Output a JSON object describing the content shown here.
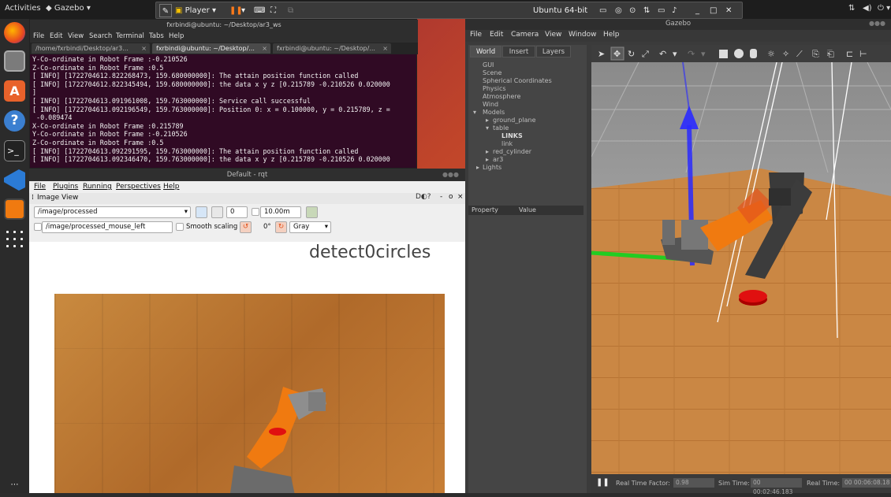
{
  "topbar": {
    "activities": "Activities",
    "app": "Gazebo",
    "vm_player": "Player",
    "vm_name": "Ubuntu 64-bit"
  },
  "terminal": {
    "title": "fxrbindi@ubuntu: ~/Desktop/ar3_ws",
    "menu": [
      "File",
      "Edit",
      "View",
      "Search",
      "Terminal",
      "Tabs",
      "Help"
    ],
    "tabs": [
      "/home/fxrbindi/Desktop/ar3...",
      "fxrbindi@ubuntu: ~/Desktop/...",
      "fxrbindi@ubuntu: ~/Desktop/..."
    ],
    "lines": [
      "Y-Co-ordinate in Robot Frame :-0.210526",
      "Z-Co-ordinate in Robot Frame :0.5",
      "[ INFO] [1722704612.822268473, 159.680000000]: The attain position function called",
      "[ INFO] [1722704612.822345494, 159.680000000]: the data x y z [0.215789 -0.210526 0.020000",
      "]",
      "[ INFO] [1722704613.091961008, 159.763000000]: Service call successful",
      "[ INFO] [1722704613.092196549, 159.763000000]: Position 0: x = 0.100000, y = 0.215789, z =",
      " -0.089474",
      "X-Co-ordinate in Robot Frame :0.215789",
      "Y-Co-ordinate in Robot Frame :-0.210526",
      "Z-Co-ordinate in Robot Frame :0.5",
      "[ INFO] [1722704613.092291595, 159.763000000]: The attain position function called",
      "[ INFO] [1722704613.092346470, 159.763000000]: the data x y z [0.215789 -0.210526 0.020000"
    ]
  },
  "rqt": {
    "title": "Default - rqt",
    "menu": [
      "File",
      "Plugins",
      "Running",
      "Perspectives",
      "Help"
    ],
    "plugin_title": "Image View",
    "topic": "/image/processed",
    "zoom_value": "0",
    "max_range": "10.00m",
    "mouse_topic": "/image/processed_mouse_left",
    "smooth_scaling": "Smooth scaling",
    "rotation": "0°",
    "color_scheme": "Gray",
    "overlay_text": "detect0circles"
  },
  "gazebo": {
    "title": "Gazebo",
    "menu": [
      "File",
      "Edit",
      "Camera",
      "View",
      "Window",
      "Help"
    ],
    "side_tabs": [
      "World",
      "Insert",
      "Layers"
    ],
    "tree": [
      "GUI",
      "Scene",
      "Spherical Coordinates",
      "Physics",
      "Atmosphere",
      "Wind",
      "Models",
      "ground_plane",
      "table",
      "LINKS",
      "link",
      "red_cylinder",
      "ar3",
      "Lights"
    ],
    "prop_headers": [
      "Property",
      "Value"
    ],
    "status": {
      "rtf_label": "Real Time Factor:",
      "rtf_value": "0.98",
      "sim_label": "Sim Time:",
      "sim_value": "00 00:02:46.183",
      "real_label": "Real Time:",
      "real_value": "00 00:06:08.18"
    }
  },
  "colors": {
    "terminal_bg": "#300a24",
    "accent_orange": "#e95420",
    "red_cylinder": "#e01010",
    "robot_orange": "#f07a10"
  }
}
